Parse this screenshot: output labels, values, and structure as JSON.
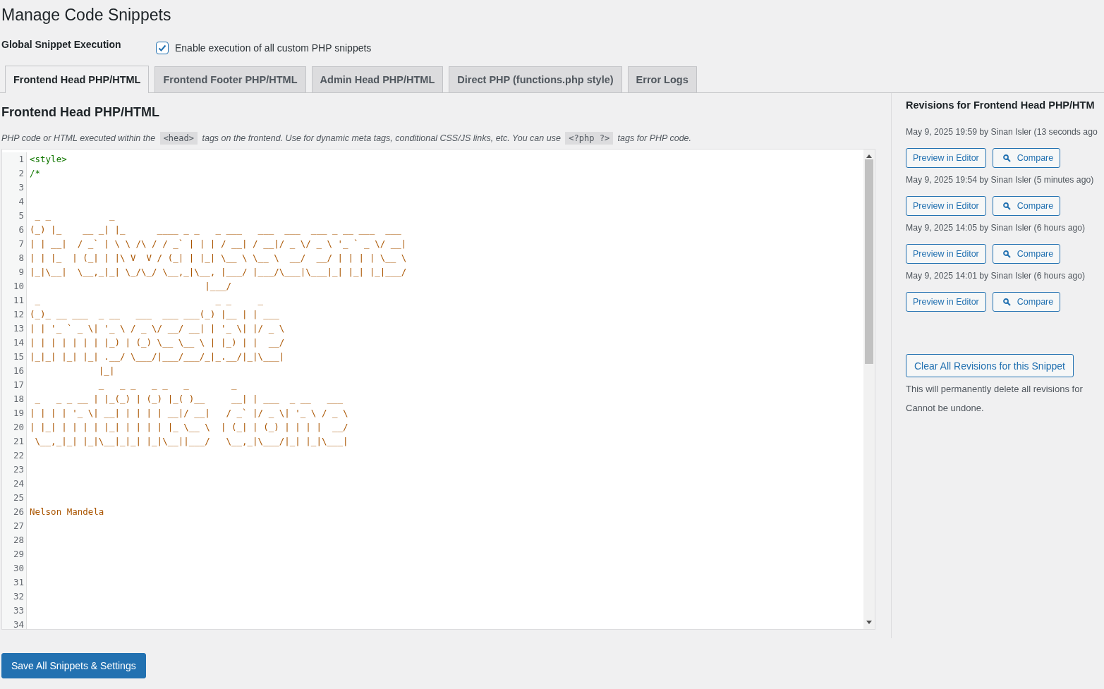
{
  "page_title": "Manage Code Snippets",
  "global_execution": {
    "label": "Global Snippet Execution",
    "checkbox_label": "Enable execution of all custom PHP snippets",
    "checked": true
  },
  "tabs": [
    {
      "label": "Frontend Head PHP/HTML",
      "selected": true
    },
    {
      "label": "Frontend Footer PHP/HTML",
      "selected": false
    },
    {
      "label": "Admin Head PHP/HTML",
      "selected": false
    },
    {
      "label": "Direct PHP (functions.php style)",
      "selected": false
    },
    {
      "label": "Error Logs",
      "selected": false
    }
  ],
  "section_title": "Frontend Head PHP/HTML",
  "description": [
    {
      "kind": "text",
      "text": "PHP code or HTML executed within the "
    },
    {
      "kind": "code",
      "text": "<head>"
    },
    {
      "kind": "text",
      "text": " tags on the frontend. Use for dynamic meta tags, conditional CSS/JS links, etc. You can use "
    },
    {
      "kind": "code",
      "text": "<?php ?>"
    },
    {
      "kind": "text",
      "text": " tags for PHP code."
    }
  ],
  "editor_lines": [
    {
      "number": "1",
      "kind": "tag",
      "text": "<style>"
    },
    {
      "number": "2",
      "kind": "tag",
      "text": "/*"
    },
    {
      "number": "3"
    },
    {
      "number": "4"
    },
    {
      "number": "5",
      "kind": "comment",
      "text": " _ _           _"
    },
    {
      "number": "6",
      "kind": "comment",
      "text": "(_) |_    __ _| |_      ____ _ _   _ ___   ___  ___  ___ _ __ ___  ___"
    },
    {
      "number": "7",
      "kind": "comment",
      "text": "| | __|  / _` | \\ \\ /\\ / / _` | | | / __| / __|/ _ \\/ _ \\ '_ ` _ \\/ __|"
    },
    {
      "number": "8",
      "kind": "comment",
      "text": "| | |_  | (_| | |\\ V  V / (_| | |_| \\__ \\ \\__ \\  __/  __/ | | | | \\__ \\"
    },
    {
      "number": "9",
      "kind": "comment",
      "text": "|_|\\__|  \\__,_|_| \\_/\\_/ \\__,_|\\__, |___/ |___/\\___|\\___|_| |_| |_|___/"
    },
    {
      "number": "10",
      "kind": "comment",
      "text": "                                 |___/"
    },
    {
      "number": "11",
      "kind": "comment",
      "text": " _                                 _ _     _"
    },
    {
      "number": "12",
      "kind": "comment",
      "text": "(_)_ __ ___  _ __   ___  ___ ___(_) |__ | | ___"
    },
    {
      "number": "13",
      "kind": "comment",
      "text": "| | '_ ` _ \\| '_ \\ / _ \\/ __/ __| | '_ \\| |/ _ \\"
    },
    {
      "number": "14",
      "kind": "comment",
      "text": "| | | | | | | |_) | (_) \\__ \\__ \\ | |_) | |  __/"
    },
    {
      "number": "15",
      "kind": "comment",
      "text": "|_|_| |_| |_| .__/ \\___/|___/___/_|_.__/|_|\\___|"
    },
    {
      "number": "16",
      "kind": "comment",
      "text": "             |_|"
    },
    {
      "number": "17",
      "kind": "comment",
      "text": "             _   _ _   _ _   _        _"
    },
    {
      "number": "18",
      "kind": "comment",
      "text": " _   _ _ __ | |_(_) | (_) |_( )__     __| | ___  _ __   ___"
    },
    {
      "number": "19",
      "kind": "comment",
      "text": "| | | | '_ \\| __| | | | | __|/ __|   / _` |/ _ \\| '_ \\ / _ \\"
    },
    {
      "number": "20",
      "kind": "comment",
      "text": "| |_| | | | | |_| | | | | |_ \\__ \\  | (_| | (_) | | | |  __/"
    },
    {
      "number": "21",
      "kind": "comment",
      "text": " \\__,_|_| |_|\\__|_|_| |_|\\__||___/   \\__,_|\\___/|_| |_|\\___|"
    },
    {
      "number": "22"
    },
    {
      "number": "23"
    },
    {
      "number": "24"
    },
    {
      "number": "25"
    },
    {
      "number": "26",
      "kind": "comment",
      "text": "Nelson Mandela"
    },
    {
      "number": "27"
    },
    {
      "number": "28"
    },
    {
      "number": "29"
    },
    {
      "number": "30"
    },
    {
      "number": "31"
    },
    {
      "number": "32"
    },
    {
      "number": "33"
    },
    {
      "number": "34"
    }
  ],
  "save_button": "Save All Snippets & Settings",
  "revisions": {
    "title": "Revisions for Frontend Head PHP/HTM",
    "items": [
      {
        "meta": "May 9, 2025 19:59 by Sinan Isler (13 seconds ago",
        "preview": "Preview in Editor",
        "compare": "Compare"
      },
      {
        "meta": "May 9, 2025 19:54 by Sinan Isler (5 minutes ago)",
        "preview": "Preview in Editor",
        "compare": "Compare"
      },
      {
        "meta": "May 9, 2025 14:05 by Sinan Isler (6 hours ago)",
        "preview": "Preview in Editor",
        "compare": "Compare"
      },
      {
        "meta": "May 9, 2025 14:01 by Sinan Isler (6 hours ago)",
        "preview": "Preview in Editor",
        "compare": "Compare"
      }
    ],
    "clear_button": "Clear All Revisions for this Snippet",
    "warning_lines": [
      "This will permanently delete all revisions for",
      "Cannot be undone."
    ]
  }
}
